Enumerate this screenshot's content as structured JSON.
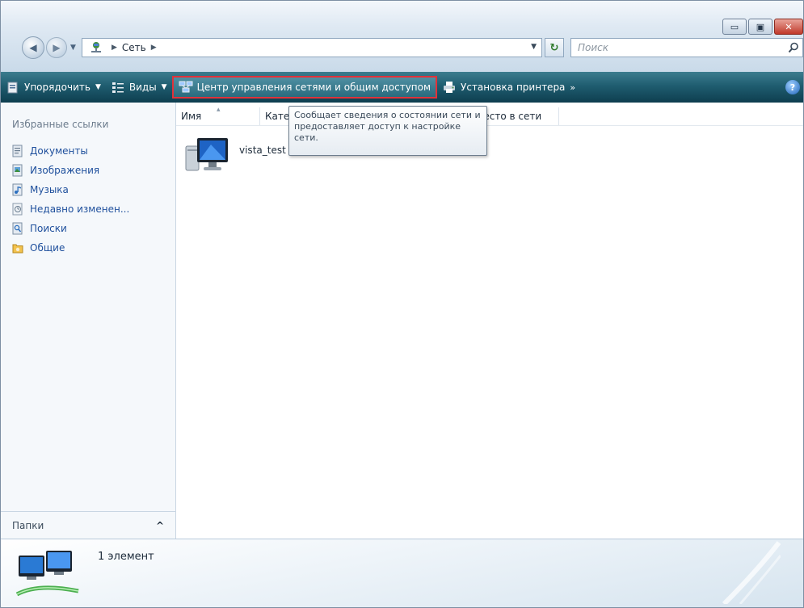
{
  "window": {
    "caption_buttons": [
      "minimize-icon",
      "maximize-icon",
      "close-icon"
    ]
  },
  "address": {
    "root_icon": "network-icon",
    "path": [
      "Сеть"
    ],
    "search_placeholder": "Поиск"
  },
  "toolbar": {
    "organize": "Упорядочить",
    "views": "Виды",
    "network_center": "Центр управления сетями и общим доступом",
    "add_printer": "Установка принтера",
    "more": "»"
  },
  "nav": {
    "heading": "Избранные ссылки",
    "items": [
      {
        "label": "Документы",
        "icon": "documents-icon"
      },
      {
        "label": "Изображения",
        "icon": "pictures-icon"
      },
      {
        "label": "Музыка",
        "icon": "music-icon"
      },
      {
        "label": "Недавно изменен...",
        "icon": "recent-icon"
      },
      {
        "label": "Поиски",
        "icon": "searches-icon"
      },
      {
        "label": "Общие",
        "icon": "public-folder-icon"
      }
    ],
    "folders_label": "Папки"
  },
  "content": {
    "columns": [
      "Имя",
      "Категория",
      "Место в сети"
    ],
    "items": [
      {
        "label": "vista_test",
        "icon": "computer-icon"
      }
    ],
    "tooltip": "Сообщает сведения о состоянии сети и предоставляет доступ к настройке сети."
  },
  "details": {
    "count": "1 элемент"
  },
  "colors": {
    "toolbar": "#1f5d70",
    "highlight_border": "#e0323a",
    "link": "#1e4f9c"
  }
}
